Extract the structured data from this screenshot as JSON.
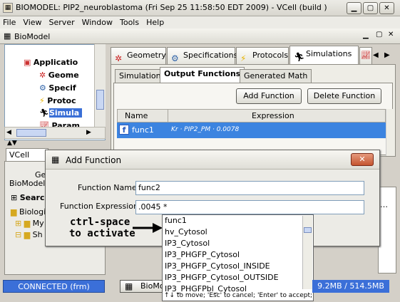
{
  "window": {
    "title": "BIOMODEL: PIP2_neuroblastoma (Fri Sep 25 11:58:50 EDT 2009) - VCell  (build )"
  },
  "menu": [
    "File",
    "View",
    "Server",
    "Window",
    "Tools",
    "Help"
  ],
  "internal_frame": {
    "title": "BioModel"
  },
  "tree": {
    "items": [
      {
        "label": "Applicatio"
      },
      {
        "label": "Geome"
      },
      {
        "label": "Specif"
      },
      {
        "label": "Protoc"
      },
      {
        "label": "Simula"
      },
      {
        "label": "Param"
      }
    ]
  },
  "left_lower": {
    "tab": "VCell Data",
    "label_ge": "Ge",
    "label_biomodels": "BioModels",
    "label_search": "Searc",
    "label_biolog": "Biologi",
    "label_my": "My",
    "label_sh": "Sh"
  },
  "tabs": [
    {
      "label": "Geometry",
      "icon": "geometry-icon"
    },
    {
      "label": "Specifications",
      "icon": "gear-icon"
    },
    {
      "label": "Protocols",
      "icon": "lightning-icon"
    },
    {
      "label": "Simulations",
      "icon": "runner-icon"
    }
  ],
  "subtabs": [
    "Simulations",
    "Output Functions",
    "Generated Math"
  ],
  "buttons": {
    "add_function": "Add Function",
    "delete_function": "Delete Function"
  },
  "table": {
    "headers": [
      "Name",
      "Expression"
    ],
    "rows": [
      {
        "name": "func1",
        "expression": "Kr · PIP2_PM · 0.0078"
      }
    ]
  },
  "dialog": {
    "title": "Add Function",
    "name_label": "Function Name",
    "name_value": "func2",
    "expr_label": "Function Expression",
    "expr_value": ".0045 *"
  },
  "autocomplete": {
    "items": [
      "func1",
      "hv_Cytosol",
      "IP3_Cytosol",
      "IP3_PHGFP_Cytosol",
      "IP3_PHGFP_Cytosol_INSIDE",
      "IP3_PHGFP_Cytosol_OUTSIDE",
      "IP3_PHGFPbl_Cytosol"
    ],
    "hint": "↑↓ to move; 'Esc' to cancel; 'Enter' to accept;"
  },
  "annotation": {
    "line1": "ctrl-space",
    "line2": "to activate"
  },
  "status": {
    "connection": "CONNECTED (frm)",
    "bio_tab": "BioMo",
    "memory": "9.2MB / 514.5MB"
  }
}
